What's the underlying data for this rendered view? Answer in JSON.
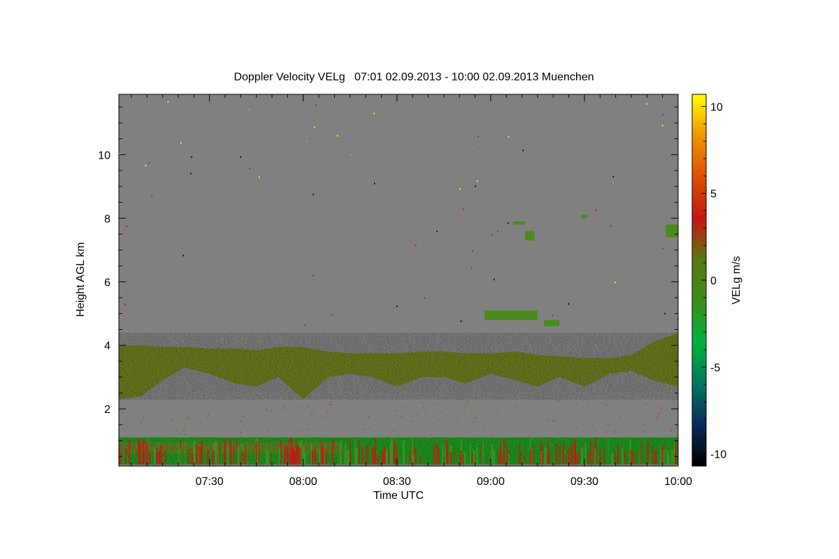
{
  "chart_data": {
    "type": "heatmap",
    "title": "Doppler Velocity VELg   07:01 02.09.2013 - 10:00 02.09.2013 Muenchen",
    "xlabel": "Time UTC",
    "ylabel": "Height AGL km",
    "colorbar_label": "VELg m/s",
    "x_range": [
      "07:01",
      "10:00"
    ],
    "x_ticks": [
      "07:30",
      "08:00",
      "08:30",
      "09:00",
      "09:30",
      "10:00"
    ],
    "y_range": [
      0.2,
      11.9
    ],
    "y_ticks": [
      2,
      4,
      6,
      8,
      10
    ],
    "colorbar_range": [
      -10.7,
      10.7
    ],
    "colorbar_ticks": [
      -10,
      -5,
      0,
      5,
      10
    ],
    "colorbar_tick_labels": [
      "-10",
      "-5",
      "0",
      "5",
      "10"
    ],
    "colormap": [
      "#000000",
      "#0a2a5a",
      "#00785a",
      "#00b43c",
      "#3c8c1e",
      "#5a7814",
      "#c81414",
      "#dc5000",
      "#f09600",
      "#ffff00"
    ],
    "background_color": "#808080",
    "cloud_layer": {
      "time": [
        "07:01",
        "07:08",
        "07:15",
        "07:22",
        "07:30",
        "07:38",
        "07:45",
        "07:52",
        "08:00",
        "08:08",
        "08:15",
        "08:22",
        "08:30",
        "08:38",
        "08:45",
        "08:52",
        "09:00",
        "09:08",
        "09:15",
        "09:22",
        "09:30",
        "09:38",
        "09:45",
        "09:52",
        "10:00"
      ],
      "top_km": [
        4.0,
        4.0,
        3.95,
        3.95,
        3.9,
        3.9,
        3.85,
        3.95,
        3.95,
        3.8,
        3.75,
        3.75,
        3.75,
        3.8,
        3.8,
        3.75,
        3.75,
        3.8,
        3.7,
        3.65,
        3.6,
        3.6,
        3.7,
        4.1,
        4.4
      ],
      "base_km": [
        2.3,
        2.4,
        2.9,
        3.3,
        3.1,
        2.8,
        2.7,
        3.0,
        2.3,
        3.0,
        3.1,
        3.0,
        2.7,
        3.0,
        3.0,
        2.8,
        3.1,
        2.9,
        2.7,
        3.0,
        2.7,
        3.1,
        3.2,
        2.9,
        2.7
      ]
    },
    "upper_cloud_patches": [
      {
        "time": [
          "08:58",
          "09:15"
        ],
        "height_km": [
          4.8,
          5.1
        ]
      },
      {
        "time": [
          "09:17",
          "09:22"
        ],
        "height_km": [
          4.6,
          4.8
        ]
      },
      {
        "time": [
          "09:07",
          "09:11"
        ],
        "height_km": [
          7.8,
          7.9
        ]
      },
      {
        "time": [
          "09:11",
          "09:14"
        ],
        "height_km": [
          7.3,
          7.6
        ]
      },
      {
        "time": [
          "09:29",
          "09:31"
        ],
        "height_km": [
          8.0,
          8.1
        ]
      },
      {
        "time": [
          "09:56",
          "10:00"
        ],
        "height_km": [
          7.4,
          7.8
        ]
      }
    ],
    "boundary_layer": {
      "top_km": 1.1,
      "base_km": 0.25,
      "dominant_velocity_ms": -1.5
    },
    "grid": false,
    "legend": "colorbar-right"
  }
}
